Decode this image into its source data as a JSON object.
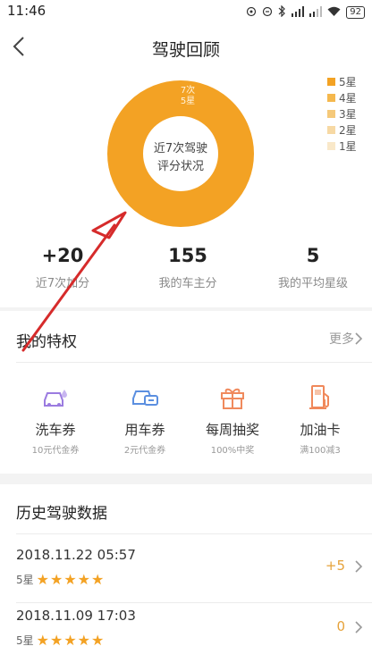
{
  "status_bar": {
    "time": "11:46",
    "battery": "92",
    "icons": [
      "dnd-icon",
      "hotspot-icon",
      "bluetooth-icon",
      "signal-icon",
      "signal-icon",
      "wifi-icon",
      "battery-icon"
    ]
  },
  "header": {
    "title": "驾驶回顾",
    "back_icon": "chevron-left-icon"
  },
  "chart_data": {
    "type": "pie",
    "subtype": "donut",
    "center_label_line1": "近7次驾驶",
    "center_label_line2": "评分状况",
    "slices": [
      {
        "label": "5星",
        "count_label": "7次",
        "value": 7,
        "color": "#f3a224"
      },
      {
        "label": "4星",
        "value": 0,
        "color": "#f5b84d"
      },
      {
        "label": "3星",
        "value": 0,
        "color": "#f5c97a"
      },
      {
        "label": "2星",
        "value": 0,
        "color": "#f7d9a4"
      },
      {
        "label": "1星",
        "value": 0,
        "color": "#f9e8c9"
      }
    ],
    "legend": [
      "5星",
      "4星",
      "3星",
      "2星",
      "1星"
    ],
    "legend_position": "top-right"
  },
  "stats": [
    {
      "value": "+20",
      "label": "近7次加分"
    },
    {
      "value": "155",
      "label": "我的车主分"
    },
    {
      "value": "5",
      "label": "我的平均星级"
    }
  ],
  "privileges": {
    "title": "我的特权",
    "more_label": "更多",
    "items": [
      {
        "name": "洗车券",
        "sub": "10元代金券",
        "icon": "car-wash-icon",
        "color": "#9b7be0"
      },
      {
        "name": "用车券",
        "sub": "2元代金券",
        "icon": "car-ticket-icon",
        "color": "#5b8fe0"
      },
      {
        "name": "每周抽奖",
        "sub": "100%中奖",
        "icon": "gift-icon",
        "color": "#f08a5d"
      },
      {
        "name": "加油卡",
        "sub": "满100减3",
        "icon": "fuel-pump-icon",
        "color": "#f0885a"
      }
    ]
  },
  "history": {
    "title": "历史驾驶数据",
    "records": [
      {
        "datetime": "2018.11.22 05:57",
        "rating": "5星",
        "stars": 5,
        "score": "+5"
      },
      {
        "datetime": "2018.11.09 17:03",
        "rating": "5星",
        "stars": 5,
        "score": "0"
      }
    ]
  }
}
